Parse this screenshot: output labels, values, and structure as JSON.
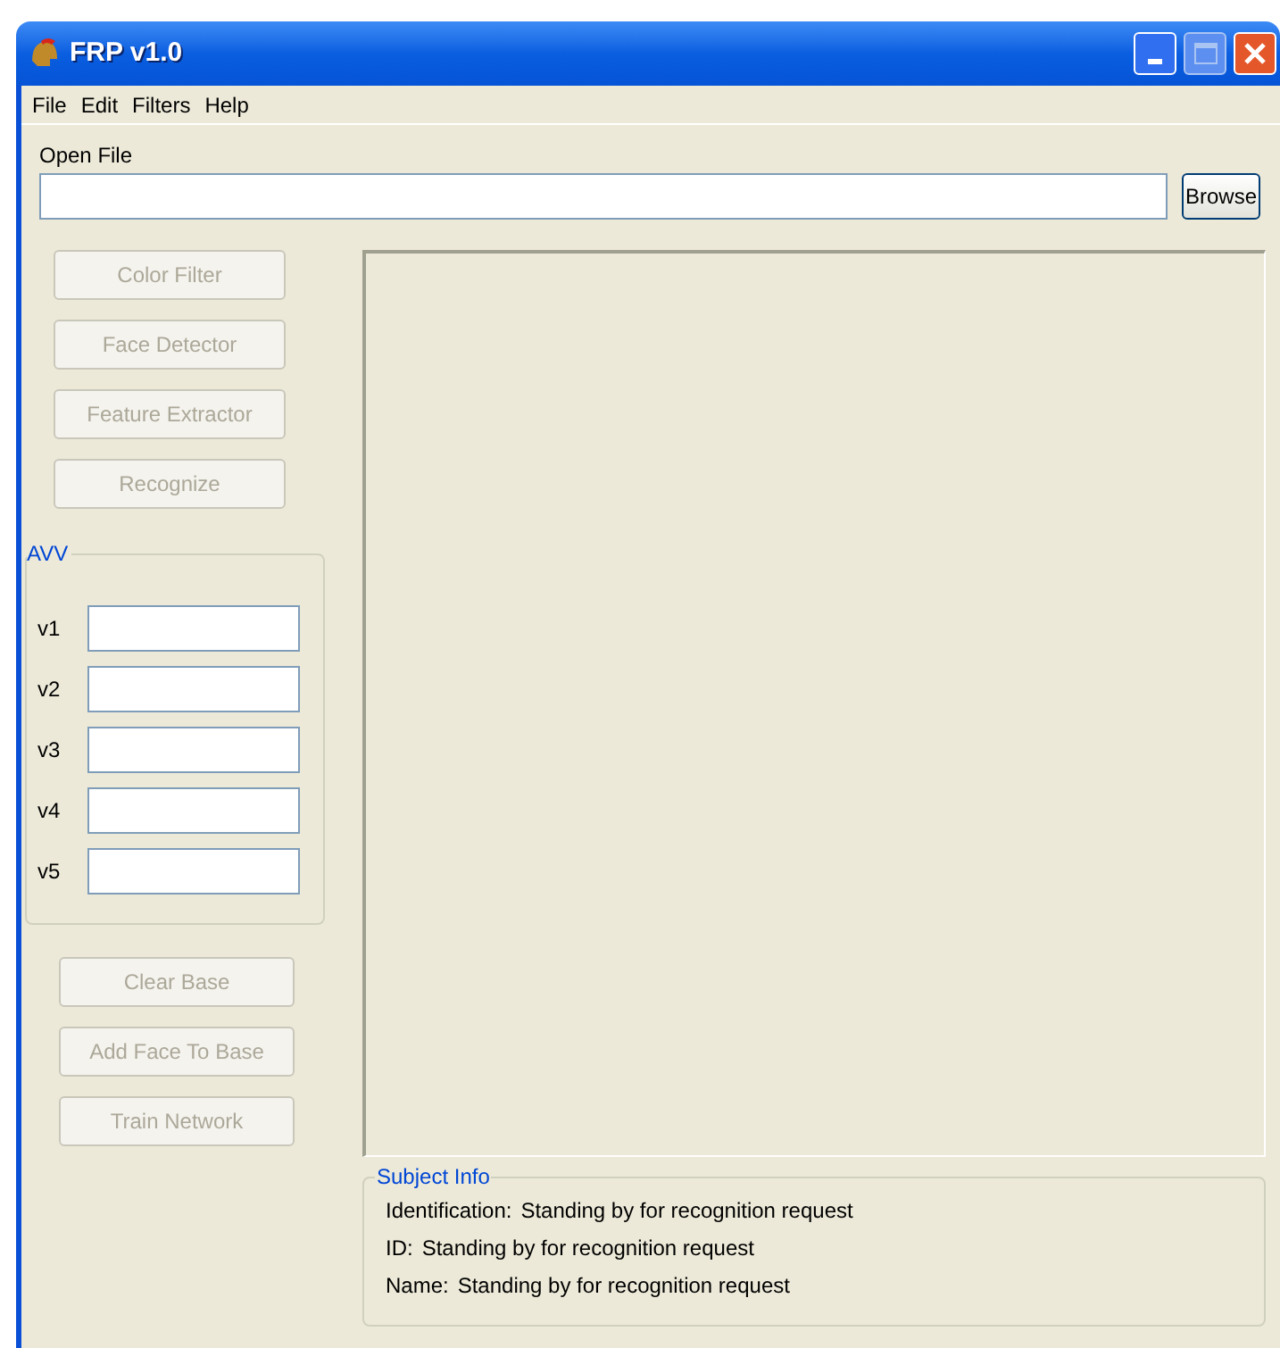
{
  "window": {
    "title": "FRP v1.0"
  },
  "menu": [
    "File",
    "Edit",
    "Filters",
    "Help"
  ],
  "open_file": {
    "label": "Open File",
    "browse": "Browse"
  },
  "tool_buttons": [
    {
      "label": "Color Filter",
      "disabled": true
    },
    {
      "label": "Face Detector",
      "disabled": true
    },
    {
      "label": "Feature Extractor",
      "disabled": true
    },
    {
      "label": "Recognize",
      "disabled": true
    }
  ],
  "avv": {
    "title": "AVV",
    "fields": [
      {
        "label": "v1"
      },
      {
        "label": "v2"
      },
      {
        "label": "v3"
      },
      {
        "label": "v4"
      },
      {
        "label": "v5"
      }
    ]
  },
  "base_buttons": [
    {
      "label": "Clear Base",
      "disabled": true
    },
    {
      "label": "Add Face To Base",
      "disabled": true
    },
    {
      "label": "Train Network",
      "disabled": true
    }
  ],
  "subject_info": {
    "title": "Subject Info",
    "rows": [
      {
        "label": "Identification:",
        "value": "Standing by for recognition request"
      },
      {
        "label": "ID:",
        "value": "Standing by for recognition request"
      },
      {
        "label": "Name:",
        "value": "Standing by for recognition request"
      }
    ]
  }
}
